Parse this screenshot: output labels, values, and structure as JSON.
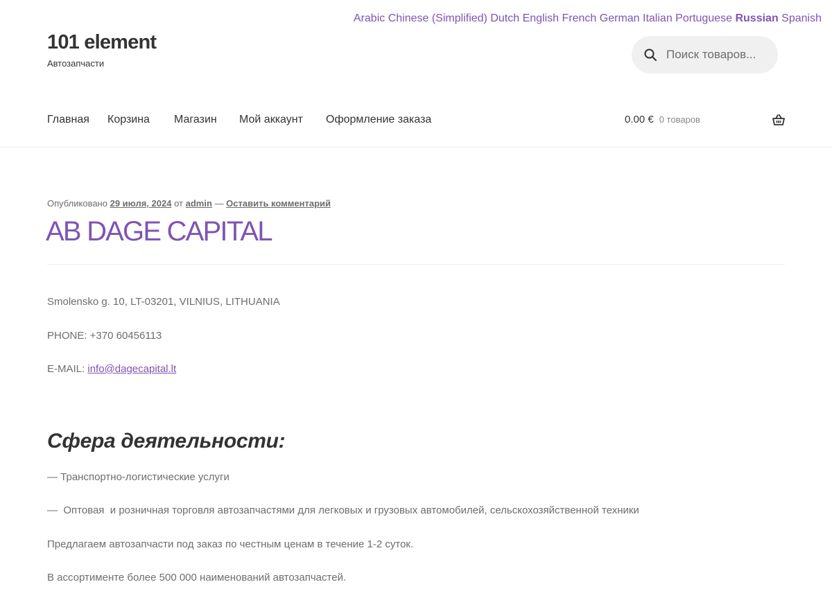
{
  "languages": {
    "items": [
      "Arabic",
      "Chinese (Simplified)",
      "Dutch",
      "English",
      "French",
      "German",
      "Italian",
      "Portuguese",
      "Russian",
      "Spanish"
    ],
    "active": "Russian"
  },
  "site": {
    "title": "101 element",
    "description": "Автозапчасти"
  },
  "search": {
    "placeholder": "Поиск товаров..."
  },
  "nav": {
    "items": [
      "Главная",
      "Корзина",
      "Магазин",
      "Мой аккаунт",
      "Оформление заказа"
    ]
  },
  "cart": {
    "amount": "0.00 €",
    "count": "0 товаров"
  },
  "post": {
    "meta_published": "Опубликовано",
    "date": "29 июля, 2024",
    "meta_by": "от",
    "author": "admin",
    "meta_dash": "—",
    "comment_link": "Оставить комментарий",
    "title": "AB DAGE CAPITAL",
    "address": "Smolensko g. 10, LT-03201, VILNIUS, LITHUANIA",
    "phone": "PHONE: +370 60456113",
    "email_label": "E-MAIL:",
    "email": "info@dagecapital.lt",
    "section_heading": "Сфера деятельности:",
    "activity_1": "— Транспортно-логистические услуги",
    "activity_2": "—  Оптовая  и розничная торговля автозапчастями для легковых и грузовых автомобилей, сельскохозяйственной техники",
    "offer": "Предлагаем автозапчасти под заказ по честным ценам в течение 1-2 суток.",
    "assortment": "В ассортименте более 500 000 наименований автозапчастей."
  },
  "colors": {
    "accent": "#7f54b3",
    "text": "#6d6d6d",
    "heading": "#333333"
  }
}
